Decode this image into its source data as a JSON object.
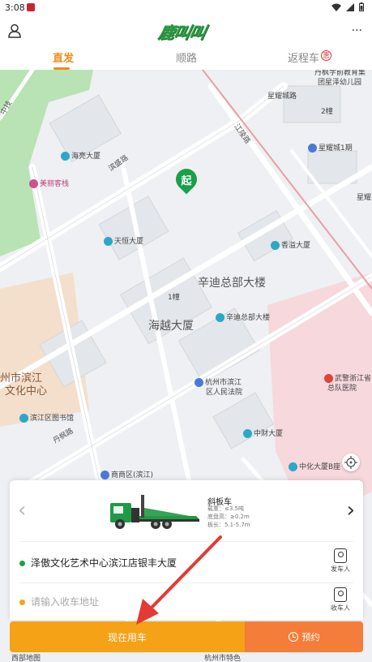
{
  "status_bar": {
    "time": "3:08"
  },
  "header": {
    "logo_text": "鹿叫叫",
    "more_label": "···"
  },
  "tabs": [
    {
      "label": "直发",
      "active": true
    },
    {
      "label": "顺路",
      "active": false
    },
    {
      "label": "返程车",
      "active": false,
      "badge": "惠"
    }
  ],
  "map": {
    "labels": {
      "danfeng_school": "丹枫学前教育集",
      "danfeng_school2": "团星泽幼儿园",
      "xingyao_city": "星耀城路",
      "haike": "海亮大厦",
      "binsheng": "滨盛路",
      "meili": "美丽客栈",
      "tianheng": "天恒大厦",
      "xiangyun": "香溢大厦",
      "xindi_big": "辛迪总部大楼",
      "haiyue_big": "海越大厦",
      "building1": "1幢",
      "xindi_small": "辛迪总部大楼",
      "court": "杭州市滨江",
      "court2": "区人民法院",
      "library": "滨江区图书馆",
      "binjiang_culture": "州市滨江",
      "binjiang_culture2": "文化中心",
      "danfeng_rd": "丹枫路",
      "zhongcai": "中财大厦",
      "wujing": "武警浙江省",
      "wujing2": "总队医院",
      "zhonghua": "中化大厦B座",
      "shangshang": "商商区(滨江)",
      "xingyao1": "星耀城1期",
      "jiangling": "江陵路",
      "num_2": "2幢",
      "star_right": "星耀",
      "stub_left": "中技",
      "footer_left": "西部地图",
      "footer_right": "杭州市特色"
    },
    "start_pin": "起"
  },
  "vehicle": {
    "name": "斜板车",
    "specs": [
      "载重：≤3.5吨",
      "底盘高：≥0.2m",
      "板长：5.1-5.7m"
    ]
  },
  "route": {
    "sender_address": "泽傲文化艺术中心滨江店银丰大厦",
    "sender_contact": "发车人",
    "receiver_placeholder": "请输入收车地址",
    "receiver_contact": "收车人"
  },
  "actions": {
    "use_now": "现在用车",
    "book": "预约"
  },
  "colors": {
    "accent": "#f08c1a",
    "primary_button": "#f5a216",
    "secondary_button": "#f47d3a",
    "start_green": "#19a04a",
    "arrow_red": "#e53935"
  }
}
